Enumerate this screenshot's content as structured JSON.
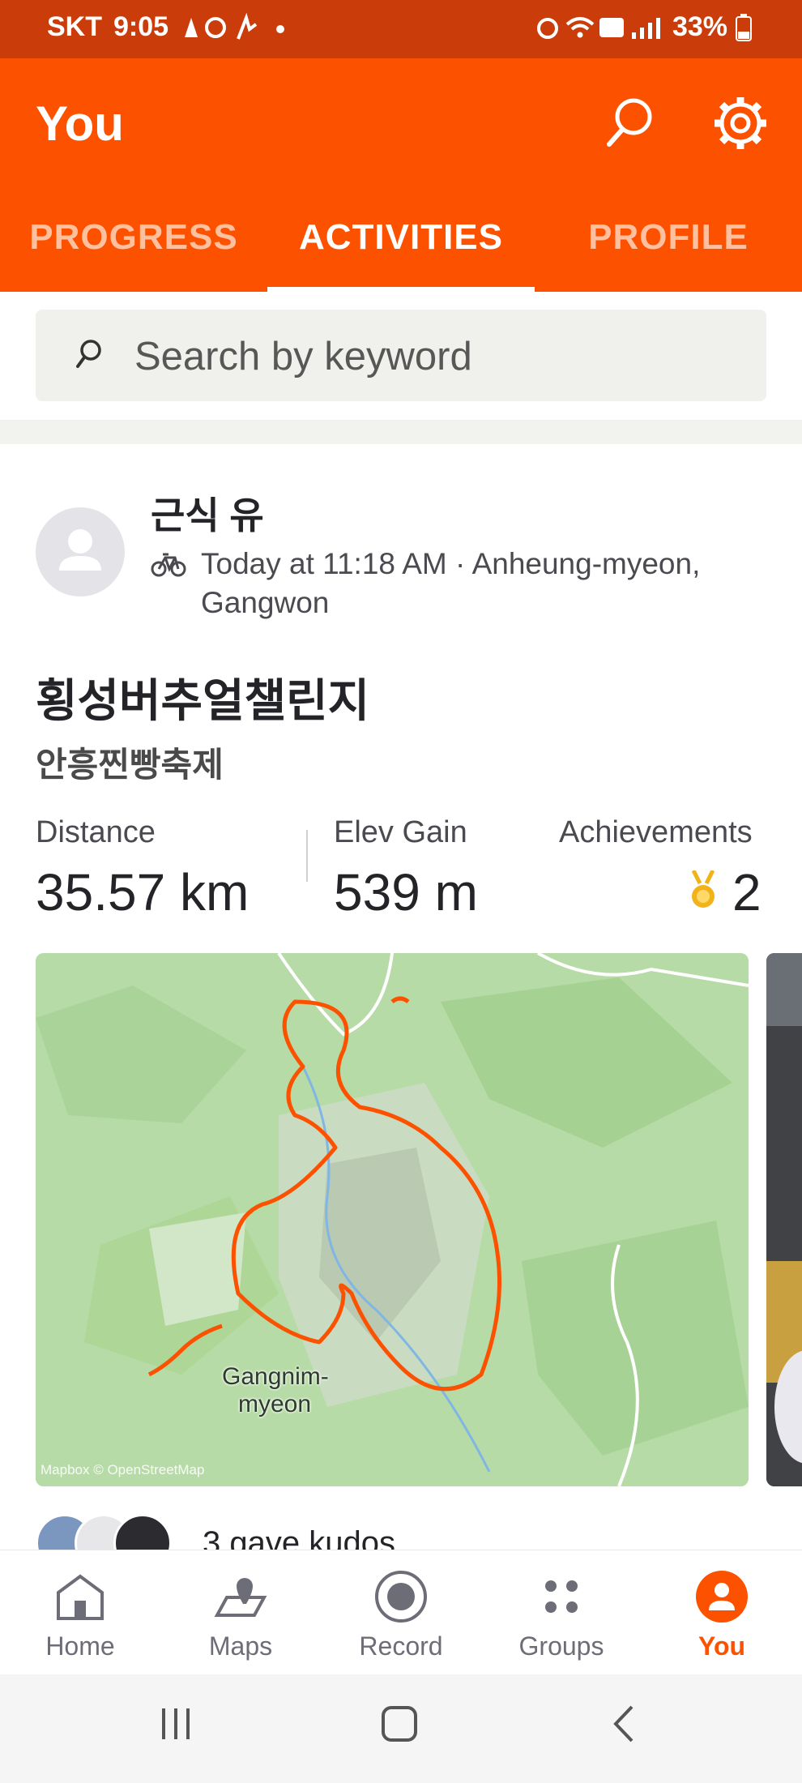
{
  "status_bar": {
    "carrier": "SKT",
    "time": "9:05",
    "battery": "33%"
  },
  "header": {
    "title": "You"
  },
  "tabs": [
    {
      "label": "PROGRESS"
    },
    {
      "label": "ACTIVITIES"
    },
    {
      "label": "PROFILE"
    }
  ],
  "search": {
    "placeholder": "Search by keyword"
  },
  "activity": {
    "athlete": "근식 유",
    "meta": "Today at 11:18 AM · Anheung-myeon, Gangwon",
    "title": "횡성버추얼챌린지",
    "description": "안흥찐빵축제",
    "stats": {
      "distance_label": "Distance",
      "distance_value": "35.57 km",
      "elev_label": "Elev Gain",
      "elev_value": "539 m",
      "ach_label": "Achievements",
      "ach_value": "2"
    },
    "map": {
      "place_label_line1": "Gangnim-",
      "place_label_line2": "myeon",
      "credit": "Mapbox © OpenStreetMap"
    },
    "kudos": "3 gave kudos"
  },
  "nav": [
    {
      "label": "Home"
    },
    {
      "label": "Maps"
    },
    {
      "label": "Record"
    },
    {
      "label": "Groups"
    },
    {
      "label": "You"
    }
  ],
  "colors": {
    "brand": "#fc5200",
    "status_bar": "#ca3c0a",
    "route": "#fc5200"
  }
}
